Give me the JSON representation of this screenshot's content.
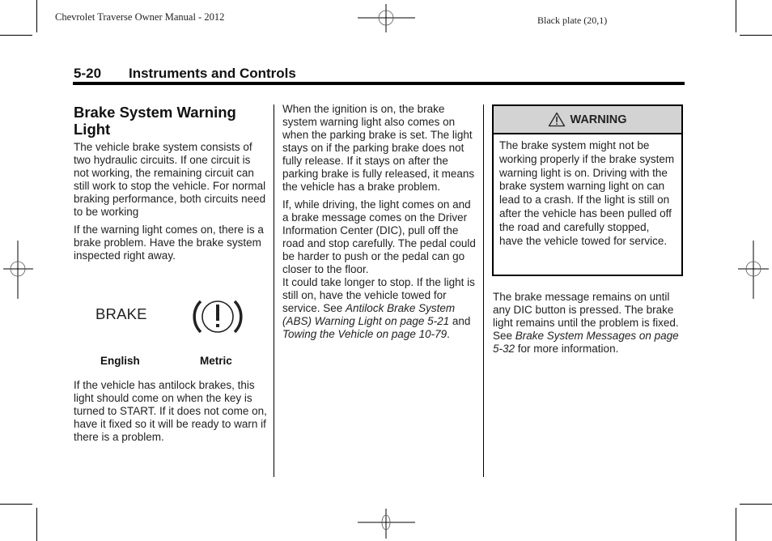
{
  "print_header": {
    "left": "Chevrolet Traverse Owner Manual - 2012",
    "right": "Black plate (20,1)"
  },
  "section": {
    "number": "5-20",
    "title": "Instruments and Controls"
  },
  "col1": {
    "heading": "Brake System Warning Light",
    "p1": "The vehicle brake system consists of two hydraulic circuits. If one circuit is not working, the remaining circuit can still work to stop the vehicle. For normal braking performance, both circuits need to be working",
    "p2": "If the warning light comes on, there is a brake problem. Have the brake system inspected right away.",
    "icons": {
      "english_symbol_text": "BRAKE",
      "english_label": "English",
      "metric_symbol": "brake-warning-circle-exclamation-icon",
      "metric_label": "Metric"
    },
    "p3": "If the vehicle has antilock brakes, this light should come on when the key is turned to START. If it does not come on, have it fixed so it will be ready to warn if there is a problem."
  },
  "col2": {
    "p1": "When the ignition is on, the brake system warning light also comes on when the parking brake is set. The light stays on if the parking brake does not fully release. If it stays on after the parking brake is fully released, it means the vehicle has a brake problem.",
    "p2": "If, while driving, the light comes on and a brake message comes on the Driver Information Center (DIC), pull off the road and stop carefully. The pedal could be harder to push or the pedal can go closer to the floor.",
    "p3_start": "It could take longer to stop. If the light is still on, have the vehicle towed for service. See ",
    "p3_link1": "Antilock Brake System (ABS) Warning Light on page 5-21",
    "p3_mid": " and ",
    "p3_link2": "Towing the Vehicle on page 10-79",
    "p3_end": "."
  },
  "col3": {
    "warning": {
      "icon": "warning-triangle-icon",
      "title": "WARNING",
      "body": "The brake system might not be working properly if the brake system warning light is on. Driving with the brake system warning light on can lead to a crash. If the light is still on after the vehicle has been pulled off the road and carefully stopped, have the vehicle towed for service."
    },
    "p1_start": "The brake message remains on until any DIC button is pressed. The brake light remains until the problem is fixed. See ",
    "p1_link": "Brake System Messages on page 5-32",
    "p1_end": " for more information."
  }
}
